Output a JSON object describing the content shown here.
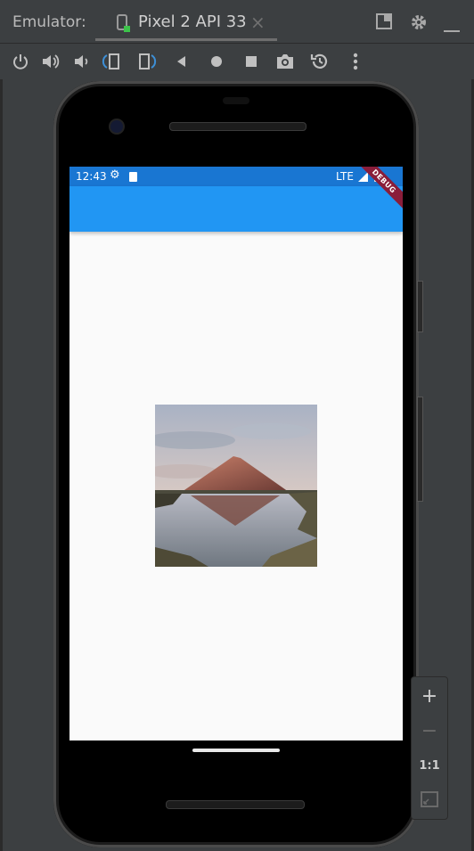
{
  "window": {
    "label": "Emulator:",
    "tab_title": "Pixel 2 API 33",
    "tab_close": "×"
  },
  "toolbar": {
    "buttons": [
      "power",
      "volume-up",
      "volume-down",
      "rotate-left",
      "rotate-right",
      "back",
      "home",
      "overview",
      "screenshot",
      "snapshot",
      "more"
    ]
  },
  "device": {
    "status_bar": {
      "time": "12:43",
      "network": "LTE"
    },
    "debug_banner": "DEBUG",
    "colors": {
      "status_bar": "#1976d2",
      "app_bar": "#2196f3",
      "background": "#fafafa"
    }
  },
  "zoom_controls": {
    "zoom_in": "+",
    "zoom_out": "−",
    "actual_size": "1:1"
  }
}
